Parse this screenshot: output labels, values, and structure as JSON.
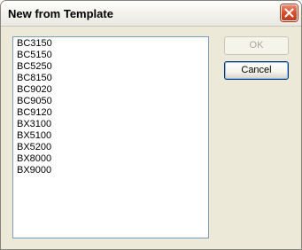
{
  "window": {
    "title": "New from Template"
  },
  "template_list": {
    "items": [
      "BC3150",
      "BC5150",
      "BC5250",
      "BC8150",
      "BC9020",
      "BC9050",
      "BC9120",
      "BX3100",
      "BX5100",
      "BX5200",
      "BX8000",
      "BX9000"
    ]
  },
  "buttons": {
    "ok_label": "OK",
    "ok_enabled": false,
    "cancel_label": "Cancel"
  },
  "icons": {
    "close": "close-icon"
  },
  "colors": {
    "close_button": "#d7502b",
    "list_border": "#7f9db9",
    "dialog_background": "#ece9d8"
  }
}
